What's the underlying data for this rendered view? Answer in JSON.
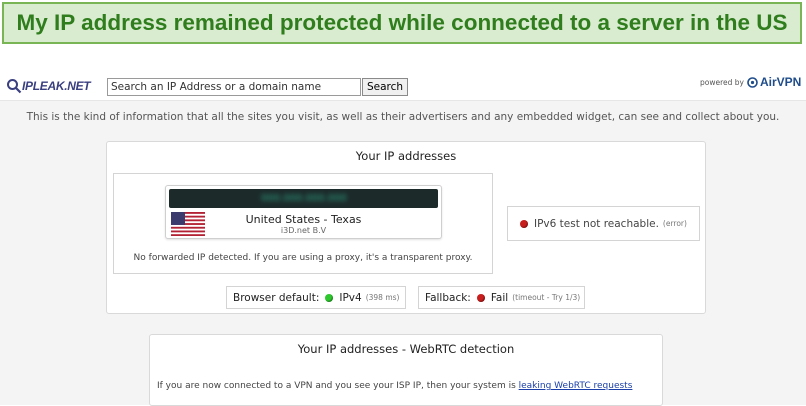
{
  "banner": {
    "text": "My IP address remained protected while connected to a server in the US"
  },
  "toolbar": {
    "logo_text": "IPLEAK.NET",
    "search_placeholder": "Search an IP Address or a domain name",
    "search_button": "Search",
    "powered_by": "powered by",
    "airvpn_text": "AirVPN"
  },
  "intro": {
    "text": "This is the kind of information that all the sites you visit, as well as their advertisers and any embedded widget, can see and collect about you."
  },
  "ip_card": {
    "title": "Your IP addresses",
    "ip_value": "000.000.000.000",
    "country": "United States - Texas",
    "isp": "i3D.net B.V",
    "note": "No forwarded IP detected. If you are using a proxy, it's a transparent proxy.",
    "ipv6_text": "IPv6 test not reachable.",
    "ipv6_status": "(error)",
    "browser_default_label": "Browser default:",
    "browser_default_value": "IPv4",
    "browser_default_ms": "(398 ms)",
    "fallback_label": "Fallback:",
    "fallback_value": "Fail",
    "fallback_detail": "(timeout - Try 1/3)"
  },
  "webrtc_card": {
    "title": "Your IP addresses - WebRTC detection",
    "text": "If you are now connected to a VPN and you see your ISP IP, then your system is ",
    "link": "leaking WebRTC requests"
  },
  "icons": {
    "logo": "magnifier-icon",
    "airvpn": "airvpn-logo-icon",
    "flag": "us-flag-icon",
    "ok": "green-status-icon",
    "fail": "red-status-icon"
  },
  "colors": {
    "banner_bg": "#d9ecd0",
    "banner_border": "#79b555",
    "banner_text": "#2f7d1d",
    "status_ok": "#2ec82e",
    "status_fail": "#c81e1e",
    "link": "#1a3fa8"
  }
}
